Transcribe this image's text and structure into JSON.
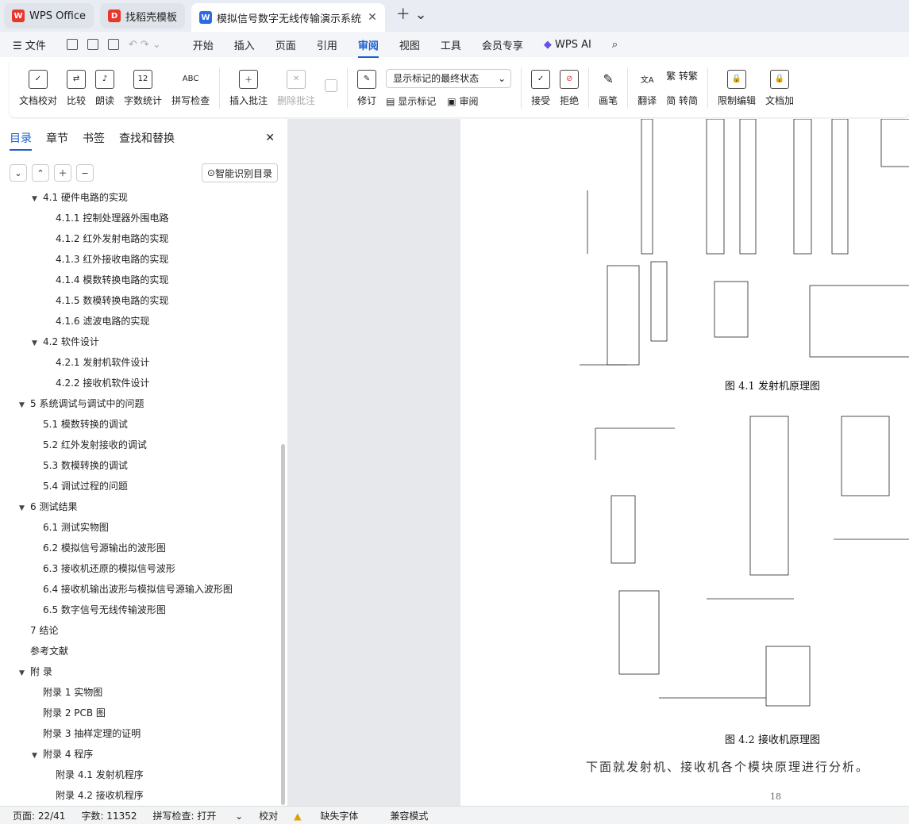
{
  "tabs": [
    {
      "label": "WPS Office"
    },
    {
      "label": "找稻壳模板"
    },
    {
      "label": "模拟信号数字无线传输演示系统"
    }
  ],
  "menu": {
    "file": "文件",
    "items": [
      "开始",
      "插入",
      "页面",
      "引用",
      "审阅",
      "视图",
      "工具",
      "会员专享"
    ],
    "ai": "WPS AI"
  },
  "ribbon": {
    "doc_check": "文档校对",
    "compare": "比较",
    "read": "朗读",
    "word_count": "字数统计",
    "spell": "拼写检查",
    "insert_comment": "插入批注",
    "delete_comment": "删除批注",
    "revise": "修订",
    "show_mode": "显示标记的最终状态",
    "show_marks": "显示标记",
    "review": "审阅",
    "accept": "接受",
    "reject": "拒绝",
    "pen": "画笔",
    "translate": "翻译",
    "to_trad": "转繁",
    "to_simp": "转简",
    "restrict": "限制编辑",
    "doc_add": "文档加"
  },
  "sidebar": {
    "tabs": [
      "目录",
      "章节",
      "书签",
      "查找和替换"
    ],
    "smart_toc": "智能识别目录",
    "toc": [
      {
        "t": "4.1  硬件电路的实现",
        "lvl": 2,
        "arr": "▼"
      },
      {
        "t": "4.1.1  控制处理器外围电路",
        "lvl": 3
      },
      {
        "t": "4.1.2  红外发射电路的实现",
        "lvl": 3
      },
      {
        "t": "4.1.3  红外接收电路的实现",
        "lvl": 3
      },
      {
        "t": "4.1.4  模数转换电路的实现",
        "lvl": 3
      },
      {
        "t": "4.1.5 数模转换电路的实现",
        "lvl": 3
      },
      {
        "t": "4.1.6 滤波电路的实现",
        "lvl": 3
      },
      {
        "t": "4.2  软件设计",
        "lvl": 2,
        "arr": "▼"
      },
      {
        "t": "4.2.1  发射机软件设计",
        "lvl": 3
      },
      {
        "t": "4.2.2  接收机软件设计",
        "lvl": 3
      },
      {
        "t": "5  系统调试与调试中的问题",
        "lvl": 1,
        "arr": "▼"
      },
      {
        "t": "5.1  模数转换的调试",
        "lvl": 2
      },
      {
        "t": "5.2  红外发射接收的调试",
        "lvl": 2
      },
      {
        "t": "5.3  数模转换的调试",
        "lvl": 2
      },
      {
        "t": "5.4  调试过程的问题",
        "lvl": 2
      },
      {
        "t": "6  测试结果",
        "lvl": 1,
        "arr": "▼"
      },
      {
        "t": "6.1  测试实物图",
        "lvl": 2
      },
      {
        "t": "6.2  模拟信号源输出的波形图",
        "lvl": 2
      },
      {
        "t": "6.3  接收机还原的模拟信号波形",
        "lvl": 2
      },
      {
        "t": "6.4  接收机输出波形与模拟信号源输入波形图",
        "lvl": 2
      },
      {
        "t": "6.5  数字信号无线传输波形图",
        "lvl": 2
      },
      {
        "t": "7  结论",
        "lvl": 1
      },
      {
        "t": "参考文献",
        "lvl": 1
      },
      {
        "t": "附  录",
        "lvl": 1,
        "arr": "▼"
      },
      {
        "t": "附录 1  实物图",
        "lvl": 2
      },
      {
        "t": "附录 2    PCB 图",
        "lvl": 2
      },
      {
        "t": "附录 3  抽样定理的证明",
        "lvl": 2
      },
      {
        "t": "附录 4  程序",
        "lvl": 2,
        "arr": "▼"
      },
      {
        "t": "附录 4.1  发射机程序",
        "lvl": 3
      },
      {
        "t": "附录 4.2  接收机程序",
        "lvl": 3
      }
    ]
  },
  "document": {
    "fig1": "图 4.1  发射机原理图",
    "fig2": "图 4.2  接收机原理图",
    "body": "下面就发射机、接收机各个模块原理进行分析。",
    "page_number": "18"
  },
  "status": {
    "page": "页面: 22/41",
    "words": "字数: 11352",
    "spell": "拼写检查: 打开",
    "proof": "校对",
    "font": "缺失字体",
    "compat": "兼容模式"
  }
}
